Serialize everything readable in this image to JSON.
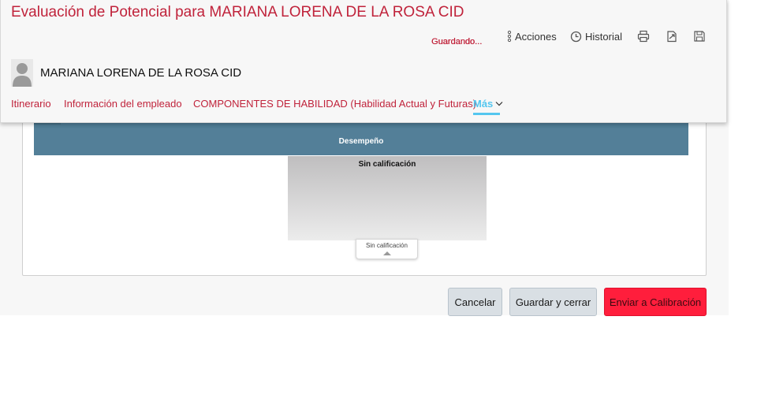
{
  "header": {
    "title": "Evaluación de Potencial para MARIANA LORENA DE LA ROSA CID",
    "status": "Guardando...",
    "toolbar": {
      "actions_label": "Acciones",
      "history_label": "Historial",
      "icons": [
        "print-icon",
        "export-pdf-icon",
        "save-icon"
      ]
    },
    "employee_name": "MARIANA LORENA DE LA ROSA CID"
  },
  "tabs": {
    "itinerario": "Itinerario",
    "info": "Información del empleado",
    "componentes": "COMPONENTES DE HABILIDAD (Habilidad Actual y Futuras)",
    "more": "Más"
  },
  "grid": {
    "axis_label": "Desempeño",
    "cell_label": "Sin calificación",
    "tooltip_label": "Sin calificación"
  },
  "footer": {
    "cancel": "Cancelar",
    "save_close": "Guardar y cerrar",
    "send": "Enviar a Calibración"
  },
  "colors": {
    "accent_red": "#c0233b",
    "tab_active": "#54c6ef",
    "grid_bar": "#537f98",
    "primary_button": "#ff1e3c"
  }
}
